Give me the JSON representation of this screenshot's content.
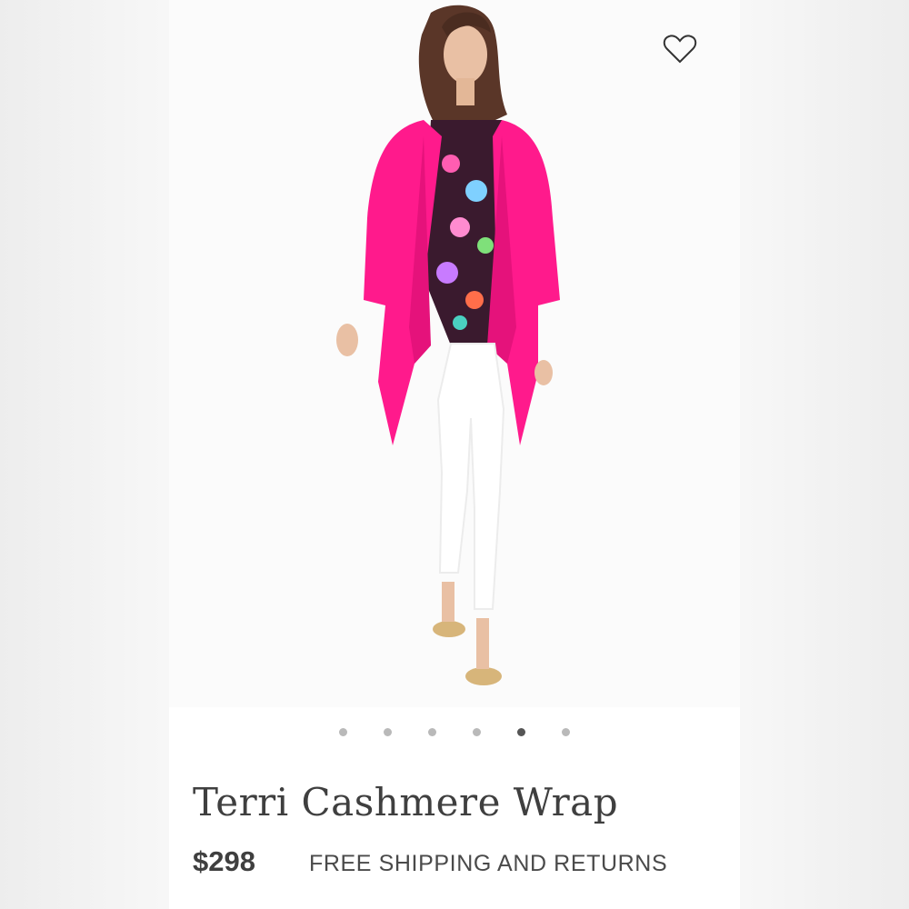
{
  "product": {
    "title": "Terri Cashmere Wrap",
    "price": "$298",
    "shipping_note": "FREE SHIPPING AND RETURNS",
    "wishlist_icon": "heart-outline-icon"
  },
  "gallery": {
    "image_count": 6,
    "active_index": 4
  },
  "colors": {
    "wrap": "#ff1a8c",
    "accent_text": "#3f3f3f",
    "dot_inactive": "#b9b9b9",
    "dot_active": "#555555"
  }
}
